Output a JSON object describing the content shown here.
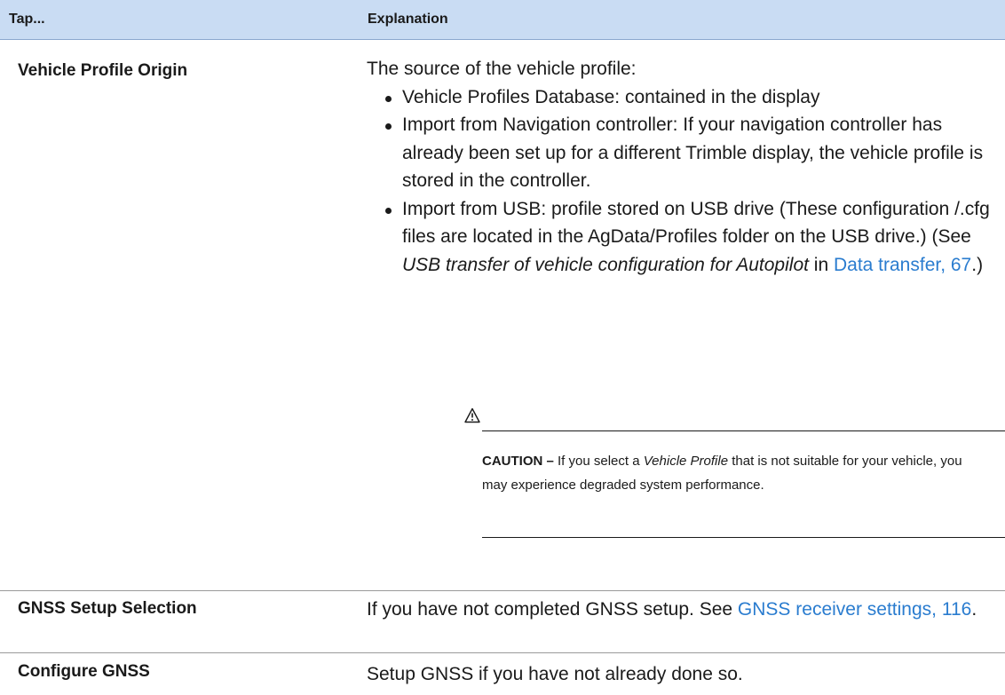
{
  "header": {
    "col_tap": "Tap...",
    "col_explanation": "Explanation"
  },
  "rows": {
    "vehicle": {
      "label": "Vehicle Profile Origin",
      "intro": "The source of the vehicle profile:",
      "bullet1": "Vehicle Profiles Database: contained in the display",
      "bullet2": "Import from Navigation controller: If your navigation controller has already been set up for a different Trimble display, the vehicle profile is stored in the controller.",
      "bullet3_a": "Import from USB: profile stored on USB drive (These configuration /.cfg files are located in the AgData/Profiles folder on the USB drive.) (See ",
      "bullet3_italic": "USB transfer of vehicle configuration for Autopilot",
      "bullet3_b": " in ",
      "bullet3_link": "Data transfer, 67",
      "bullet3_c": ".)",
      "caution_label": "CAUTION –",
      "caution_a": " If you select a ",
      "caution_italic": "Vehicle Profile",
      "caution_b": " that is not suitable for your vehicle, you may experience degraded system performance."
    },
    "gnss_setup": {
      "label": "GNSS Setup Selection",
      "text": "If you have not completed GNSS setup. See ",
      "link": "GNSS receiver settings, 116",
      "end": "."
    },
    "configure": {
      "label": "Configure GNSS",
      "text": "Setup GNSS if you have not already done so."
    }
  },
  "icons": {
    "caution": "warning-triangle-icon"
  },
  "colors": {
    "header_bg": "#c9dcf3",
    "link": "#2a7ccf"
  }
}
